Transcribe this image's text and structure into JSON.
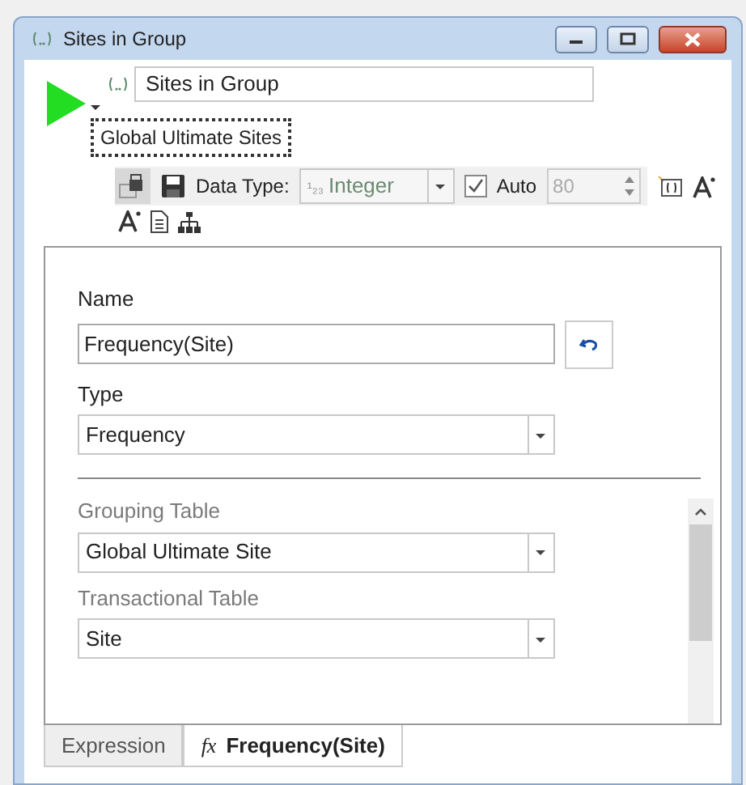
{
  "window": {
    "title": "Sites in Group"
  },
  "header": {
    "name_value": "Sites in Group",
    "description": "Global Ultimate Sites"
  },
  "toolbar": {
    "data_type_label": "Data Type:",
    "data_type_glyph": "¹₂₃",
    "data_type_value": "Integer",
    "auto_label": "Auto",
    "auto_checked": true,
    "width_value": "80",
    "width_disabled": true
  },
  "fields": [
    {
      "label": "Name",
      "kind": "text",
      "value": "Frequency(Site)",
      "muted": false
    },
    {
      "label": "Type",
      "kind": "select",
      "value": "Frequency",
      "muted": false
    },
    {
      "kind": "divider"
    },
    {
      "label": "Grouping Table",
      "kind": "select",
      "value": "Global Ultimate Site",
      "muted": true
    },
    {
      "label": "Transactional Table",
      "kind": "select",
      "value": "Site",
      "muted": true
    }
  ],
  "tabs": [
    {
      "label": "Expression",
      "selected": false
    },
    {
      "prefix": "fx",
      "label": "Frequency(Site)",
      "selected": true
    }
  ]
}
